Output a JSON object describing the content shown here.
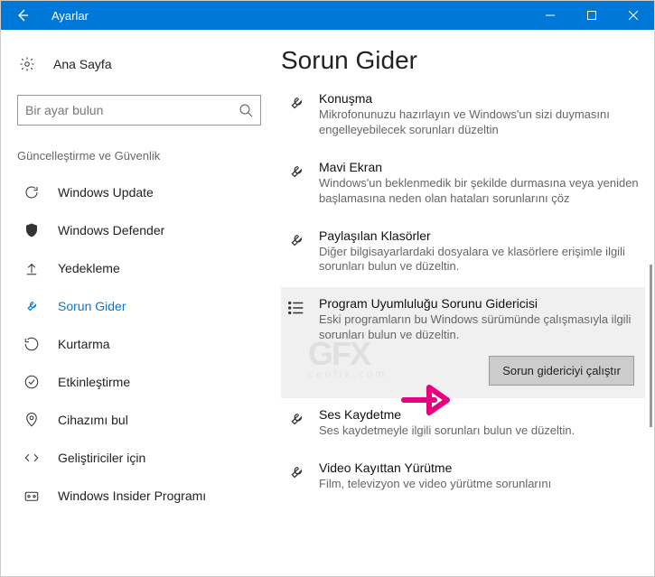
{
  "title": "Ayarlar",
  "home": "Ana Sayfa",
  "search_placeholder": "Bir ayar bulun",
  "group_heading": "Güncelleştirme ve Güvenlik",
  "nav": [
    {
      "label": "Windows Update"
    },
    {
      "label": "Windows Defender"
    },
    {
      "label": "Yedekleme"
    },
    {
      "label": "Sorun Gider",
      "active": true
    },
    {
      "label": "Kurtarma"
    },
    {
      "label": "Etkinleştirme"
    },
    {
      "label": "Cihazımı bul"
    },
    {
      "label": "Geliştiriciler için"
    },
    {
      "label": "Windows Insider Programı"
    }
  ],
  "main_heading": "Sorun Gider",
  "troubleshooters": [
    {
      "title": "Konuşma",
      "desc": "Mikrofonunuzu hazırlayın ve Windows'un sizi duymasını engelleyebilecek sorunları düzeltin"
    },
    {
      "title": "Mavi Ekran",
      "desc": "Windows'un beklenmedik bir şekilde durmasına veya yeniden başlamasına neden olan hataları sorunlarını çöz"
    },
    {
      "title": "Paylaşılan Klasörler",
      "desc": "Diğer bilgisayarlardaki dosyalara ve klasörlere erişimle ilgili sorunları bulun ve düzeltin."
    },
    {
      "title": "Program Uyumluluğu Sorunu Gidericisi",
      "desc": "Eski programların bu Windows sürümünde çalışmasıyla ilgili sorunları bulun ve düzeltin.",
      "selected": true
    },
    {
      "title": "Ses Kaydetme",
      "desc": "Ses kaydetmeyle ilgili sorunları bulun ve düzeltin."
    },
    {
      "title": "Video Kayıttan Yürütme",
      "desc": "Film, televizyon ve video yürütme sorunlarını"
    }
  ],
  "run_button": "Sorun gidericiyi çalıştır"
}
